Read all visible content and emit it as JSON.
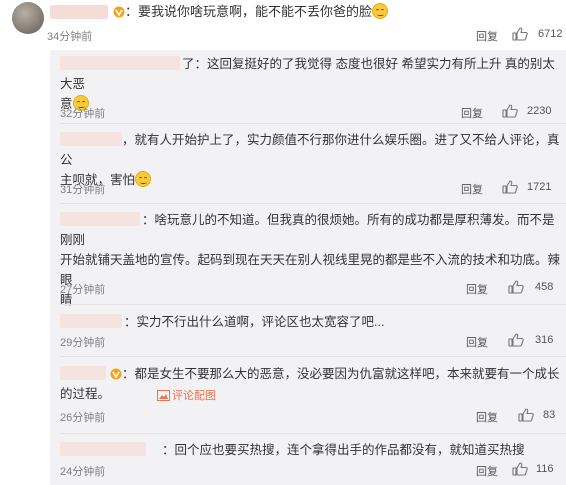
{
  "top_comment": {
    "text": "要我说你啥玩意啊，能不能不丢你爸的脸",
    "time": "34分钟前",
    "reply_label": "回复",
    "likes": "6712"
  },
  "replies": [
    {
      "line1": "了：这回复挺好的了我觉得 态度也很好 希望实力有所上升 真的别太大恶",
      "line2": "意",
      "time": "32分钟前",
      "reply_label": "回复",
      "likes": "2230"
    },
    {
      "line1": "，就有人开始护上了，实力颜值不行那你进什么娱乐圈。进了又不给人评论，真公",
      "line2": "主呗就，害怕",
      "time": "31分钟前",
      "reply_label": "回复",
      "likes": "1721"
    },
    {
      "line1": "：啥玩意儿的不知道。但我真的很烦她。所有的成功都是厚积薄发。而不是刚刚",
      "line2": "开始就铺天盖地的宣传。起码到现在天天在别人视线里晃的都是些不入流的技术和功底。辣眼",
      "line3": "睛",
      "time": "27分钟前",
      "reply_label": "回复",
      "likes": "458"
    },
    {
      "line1": "：实力不行出什么道啊，评论区也太宽容了吧...",
      "time": "29分钟前",
      "reply_label": "回复",
      "likes": "316"
    },
    {
      "line1": "：都是女生不要那么大的恶意，没必要因为仇富就这样吧，本来就要有一个成长",
      "line2": "的过程。",
      "pic_label": "评论配图",
      "time": "26分钟前",
      "reply_label": "回复",
      "likes": "83"
    },
    {
      "line1": "：回个应也要买热搜，连个拿得出手的作品都没有，就知道买热搜",
      "time": "24分钟前",
      "reply_label": "回复",
      "likes": "116"
    }
  ]
}
